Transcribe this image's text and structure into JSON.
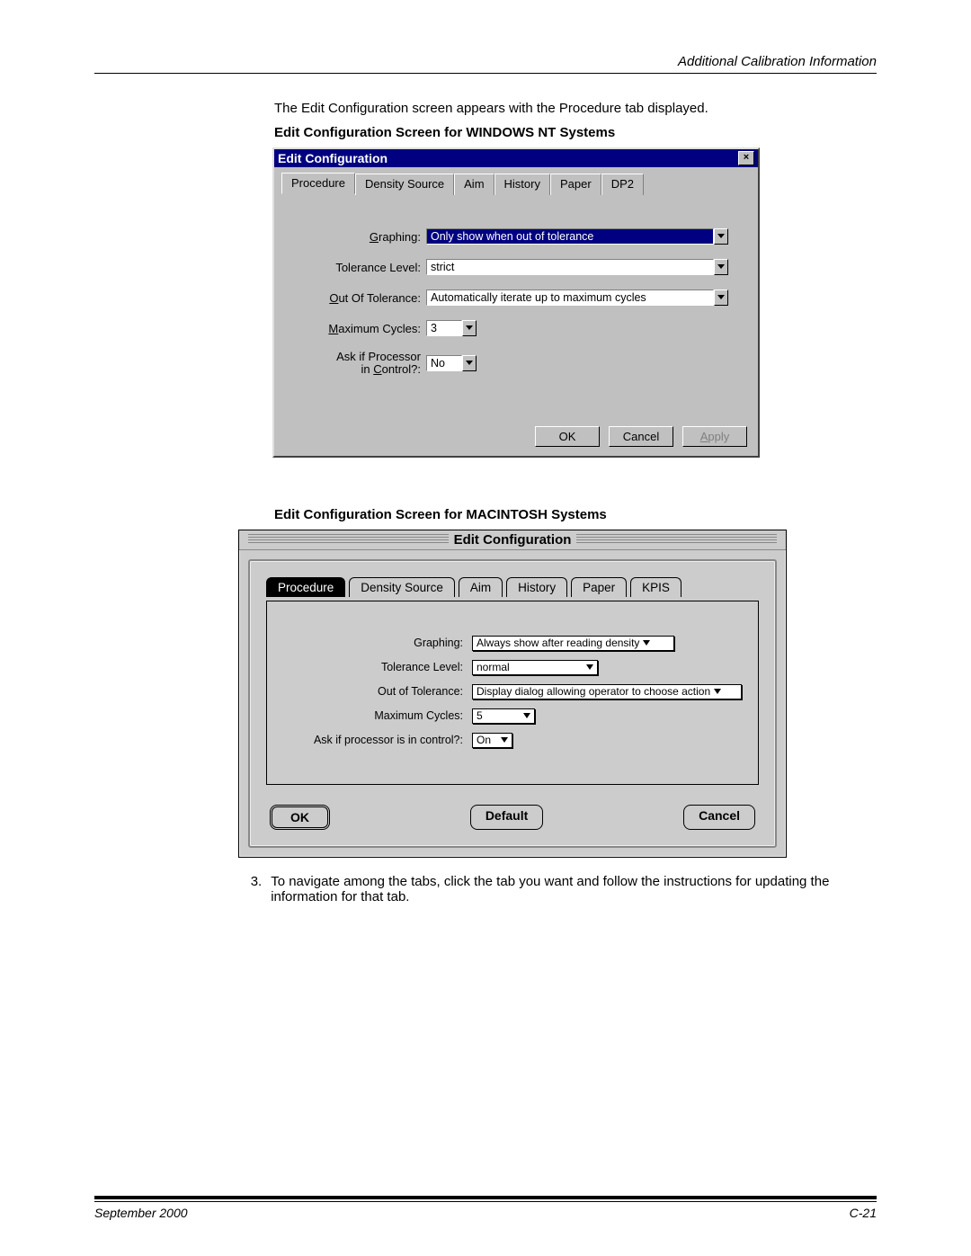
{
  "page": {
    "header_right": "Additional Calibration Information",
    "intro": "The Edit Configuration screen appears with the Procedure tab displayed.",
    "subhead_win": "Edit Configuration Screen for WINDOWS NT Systems",
    "subhead_mac": "Edit Configuration Screen for MACINTOSH Systems",
    "step_num": "3.",
    "step_text": "To navigate among the tabs, click the tab you want and follow the instructions for updating the information for that tab.",
    "footer_left": "September 2000",
    "footer_right": "C-21"
  },
  "win": {
    "title": "Edit Configuration",
    "close": "×",
    "tabs": [
      "Procedure",
      "Density Source",
      "Aim",
      "History",
      "Paper",
      "DP2"
    ],
    "labels": {
      "graphing": "Graphing:",
      "tolerance": "Tolerance Level:",
      "out_of_tolerance": "Out Of Tolerance:",
      "max_cycles": "Maximum Cycles:",
      "ask": "Ask if Processor in Control?:"
    },
    "values": {
      "graphing": "Only show when out of tolerance",
      "tolerance": "strict",
      "out_of_tolerance": "Automatically iterate up to maximum cycles",
      "max_cycles": "3",
      "ask": "No"
    },
    "buttons": {
      "ok": "OK",
      "cancel": "Cancel",
      "apply": "Apply"
    }
  },
  "mac": {
    "title": "Edit Configuration",
    "tabs": [
      "Procedure",
      "Density Source",
      "Aim",
      "History",
      "Paper",
      "KPIS"
    ],
    "labels": {
      "graphing": "Graphing:",
      "tolerance": "Tolerance Level:",
      "out_of_tolerance": "Out of Tolerance:",
      "max_cycles": "Maximum Cycles:",
      "ask": "Ask if processor is in control?:"
    },
    "values": {
      "graphing": "Always show after reading density",
      "tolerance": "normal",
      "out_of_tolerance": "Display dialog allowing operator to choose action",
      "max_cycles": "5",
      "ask": "On"
    },
    "buttons": {
      "ok": "OK",
      "default": "Default",
      "cancel": "Cancel"
    }
  }
}
